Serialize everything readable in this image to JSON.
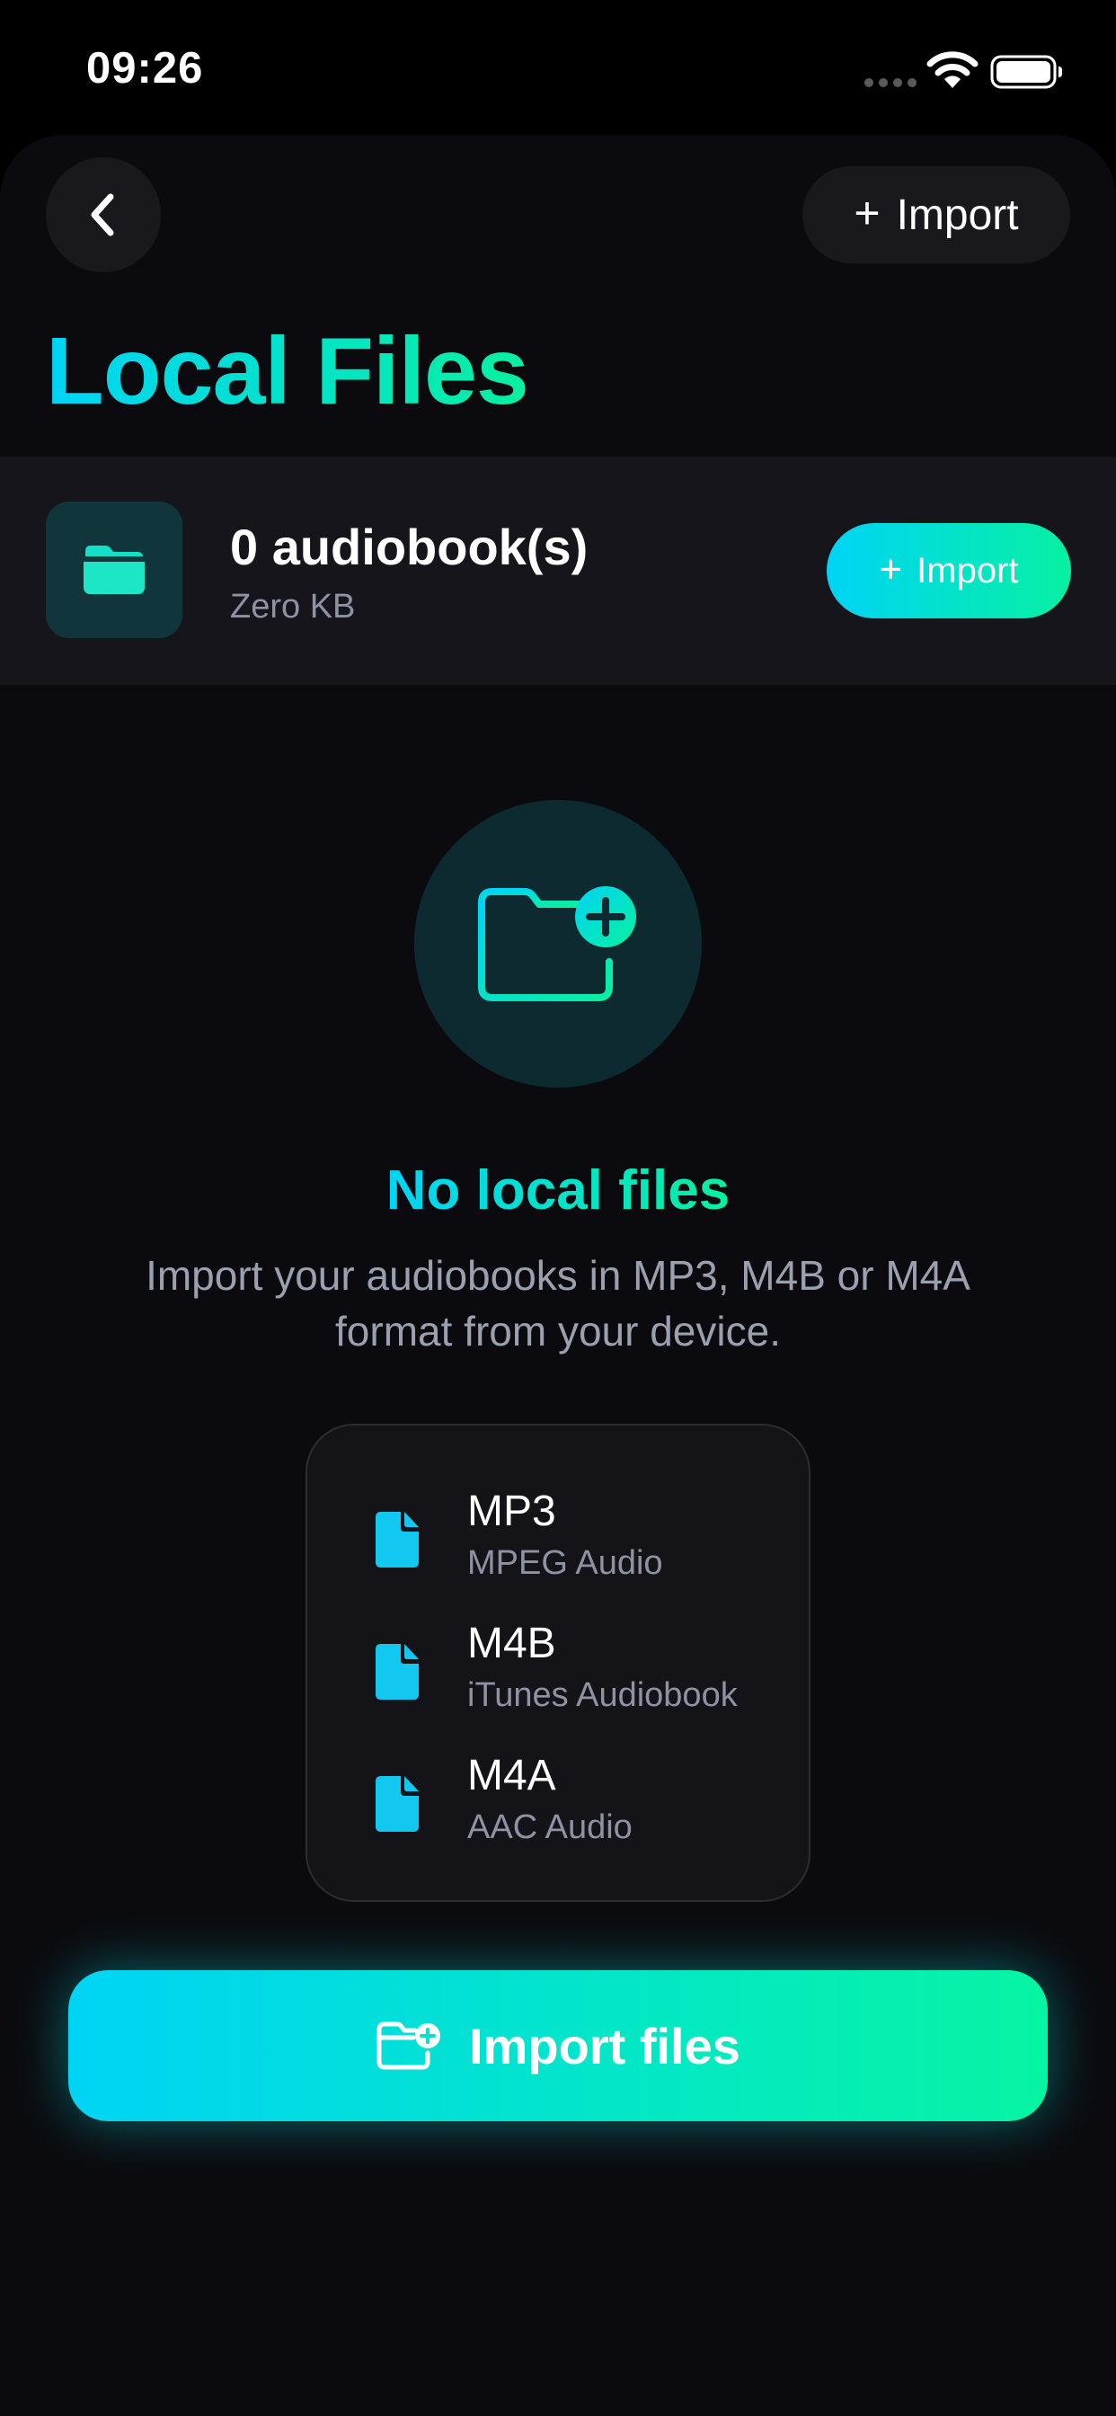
{
  "status_bar": {
    "time": "09:26"
  },
  "header": {
    "back_icon": "chevron-left-icon",
    "import_label": "Import",
    "title": "Local Files"
  },
  "summary": {
    "folder_icon": "folder-icon",
    "count_label": "0 audiobook(s)",
    "size_label": "Zero KB",
    "import_label": "Import"
  },
  "empty_state": {
    "icon": "folder-plus-icon",
    "title": "No local files",
    "description": "Import your audiobooks in MP3, M4B or M4A format from your device."
  },
  "formats": [
    {
      "name": "MP3",
      "description": "MPEG Audio",
      "icon": "file-icon"
    },
    {
      "name": "M4B",
      "description": "iTunes Audiobook",
      "icon": "file-icon"
    },
    {
      "name": "M4A",
      "description": "AAC Audio",
      "icon": "file-icon"
    }
  ],
  "primary_action": {
    "label": "Import files",
    "icon": "folder-plus-icon"
  },
  "colors": {
    "accent_start": "#00d4f5",
    "accent_end": "#05f5a3",
    "background": "#0b0b0f",
    "surface": "#15151b"
  }
}
